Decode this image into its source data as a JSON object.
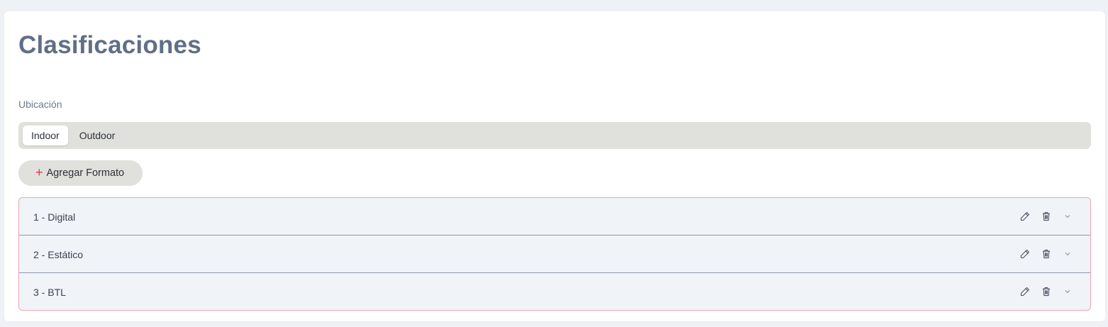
{
  "page": {
    "title": "Clasificaciones"
  },
  "ubicacion": {
    "label": "Ubicación",
    "options": [
      "Indoor",
      "Outdoor"
    ],
    "selected": "Indoor"
  },
  "actions": {
    "add_icon": "+",
    "add_label": "Agregar Formato"
  },
  "formats": [
    {
      "label": "1 - Digital"
    },
    {
      "label": "2 - Estático"
    },
    {
      "label": "3 - BTL"
    }
  ],
  "icons": {
    "edit": "pencil-icon",
    "delete": "trash-icon",
    "expand": "chevron-down-icon"
  },
  "colors": {
    "title": "#5f6f86",
    "accent": "#d93a4b",
    "segment_bg": "#e0e0dc",
    "list_border": "#f0a6b0",
    "row_bg": "#f0f3f8"
  }
}
